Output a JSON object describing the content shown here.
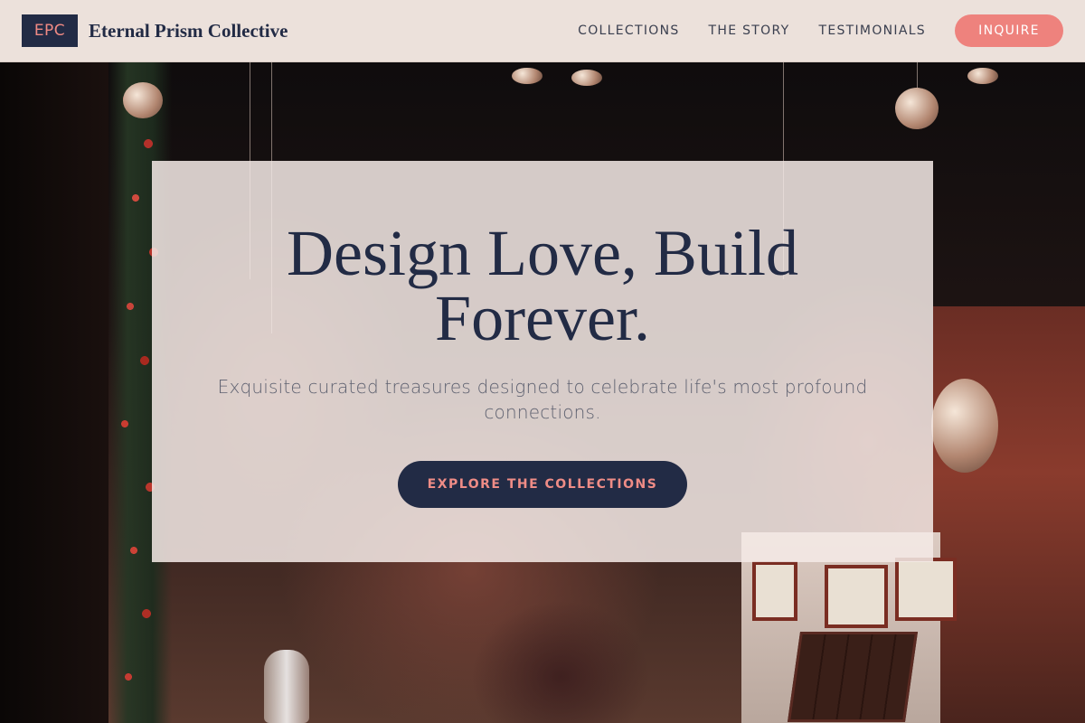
{
  "header": {
    "logo_text": "EPC",
    "brand_name": "Eternal Prism Collective",
    "nav": [
      {
        "label": "COLLECTIONS"
      },
      {
        "label": "THE STORY"
      },
      {
        "label": "TESTIMONIALS"
      }
    ],
    "inquire_label": "INQUIRE"
  },
  "hero": {
    "title": "Design Love, Build Forever.",
    "subtitle": "Exquisite curated treasures designed to celebrate life's most profound connections.",
    "cta_label": "EXPLORE THE COLLECTIONS",
    "background_image": "holiday-shop-interior-photo"
  },
  "colors": {
    "navy": "#222b45",
    "coral": "#ee827d",
    "header_bg": "#ece1db",
    "card_bg": "#f4eae6"
  }
}
